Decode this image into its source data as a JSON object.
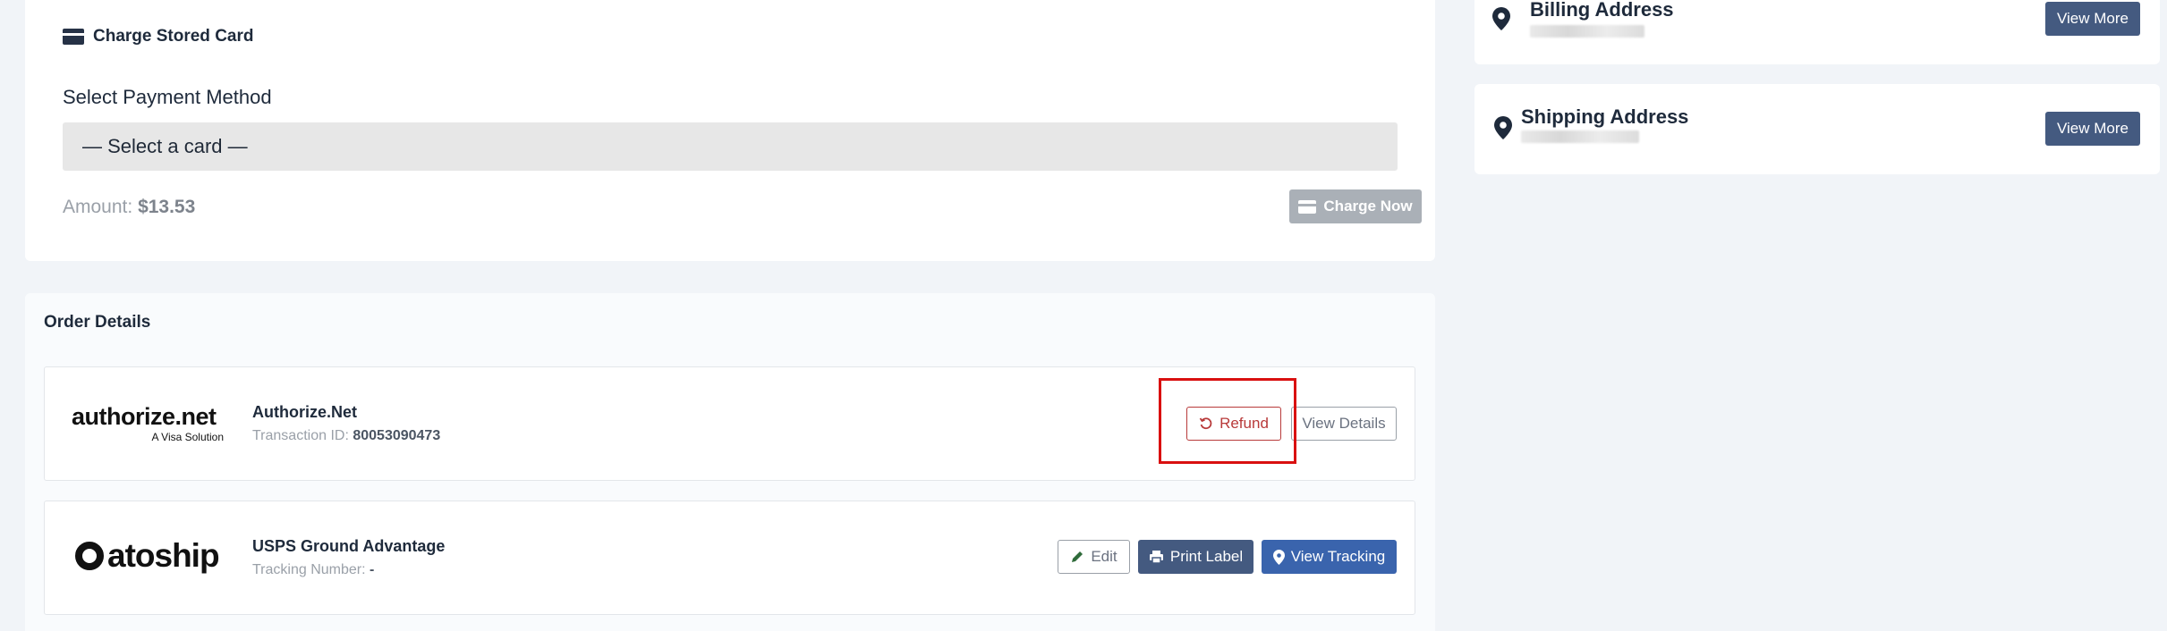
{
  "charge_card": {
    "title": "Charge Stored Card",
    "select_label": "Select Payment Method",
    "select_value": "— Select a card —",
    "amount_label": "Amount:",
    "amount_value": "$13.53",
    "charge_button": "Charge Now"
  },
  "order_details": {
    "title": "Order Details",
    "payment": {
      "logo_text": "authorize.net",
      "logo_sub": "A Visa Solution",
      "name": "Authorize.Net",
      "meta_label": "Transaction ID:",
      "meta_value": "80053090473",
      "refund_button": "Refund",
      "view_details_button": "View Details"
    },
    "shipping": {
      "logo_text": "atoship",
      "name": "USPS Ground Advantage",
      "meta_label": "Tracking Number:",
      "meta_value": "-",
      "edit_button": "Edit",
      "print_button": "Print Label",
      "tracking_button": "View Tracking"
    }
  },
  "sidebar": {
    "billing": {
      "title": "Billing Address",
      "button": "View More"
    },
    "shipping": {
      "title": "Shipping Address",
      "button": "View More"
    }
  },
  "colors": {
    "primary_button": "#445a80",
    "tracking_button": "#3a64ad",
    "refund": "#b83a3a",
    "highlight": "#d91010"
  }
}
